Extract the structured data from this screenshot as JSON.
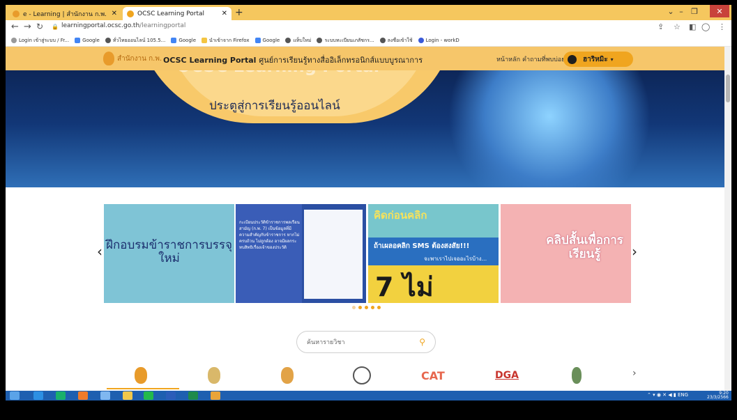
{
  "browser": {
    "tabs": [
      {
        "title": "e - Learning | สำนักงาน ก.พ. (OCSC",
        "active": false
      },
      {
        "title": "OCSC Learning Portal",
        "active": true
      }
    ],
    "url_host": "learningportal.ocsc.go.th",
    "url_path": "/learningportal",
    "bookmarks": [
      "Login เข้าสู่ระบบ / Fr...",
      "Google",
      "ทั่วไทยออนไลน์ 105.5...",
      "Google",
      "นำเข้าจาก Firefox",
      "Google",
      "แท็บใหม่",
      "ระบบทะเบียนเภสัชกร...",
      "ลงชื่อเข้าใช้",
      "Login - workD"
    ]
  },
  "site": {
    "brand": "สำนักงาน ก.พ.",
    "title": "OCSC Learning Portal",
    "title_th": "ศูนย์การเรียนรู้ทางสื่ออิเล็กทรอนิกส์แบบบูรณาการ",
    "nav": [
      "หน้าหลัก",
      "คำถามที่พบบ่อย"
    ],
    "user_name": "ฮาริหมิะ",
    "accent": "#f0a51f"
  },
  "hero": {
    "heading": "OCSC Learning Portal",
    "tagline": "ประตูสู่การเรียนรู้ออนไลน์"
  },
  "carousel": {
    "slides": [
      {
        "text": "ฝึกอบรมข้าราชการบรรจุใหม่"
      },
      {
        "text": "กะเบียนประวัติข้าราชการพลเรือนสามัญ (ก.พ. 7) เป็นข้อมูลที่มีความสำคัญกับข้าราชการ หากไม่ครบถ้วน ไม่ถูกต้อง อาจมีผลกระทบสิทธิเรื่องเจ้าของประวัติ"
      },
      {
        "heading": "คิดก่อนคลิก",
        "line2": "ถ้าเผลอคลิก SMS ต้องสงสัย!!!",
        "line3": "จะพาเราไปเจออะไรบ้าง...",
        "badge": "7 ไม่"
      },
      {
        "text": "คลิปสั้นเพื่อการเรียนรู้"
      }
    ],
    "dots_active": 1,
    "dots_total": 5,
    "prev_icon": "chevron-left-icon",
    "next_icon": "chevron-right-icon"
  },
  "search": {
    "placeholder": "ค้นหารายวิชา",
    "icon": "search-icon"
  },
  "orgs": [
    {
      "name": "ocsc-logo"
    },
    {
      "name": "org-logo-2"
    },
    {
      "name": "org-logo-3"
    },
    {
      "name": "org-logo-4"
    },
    {
      "label": "CAT"
    },
    {
      "label": "DGA"
    },
    {
      "name": "org-logo-7"
    }
  ],
  "taskbar": {
    "lang": "ENG",
    "time": "9:20",
    "date": "23/3/2566"
  }
}
